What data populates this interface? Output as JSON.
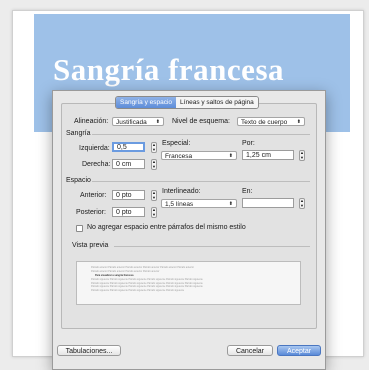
{
  "document": {
    "title": "Sangría francesa",
    "background_color": "#9ec1e8"
  },
  "dialog": {
    "tabs": [
      {
        "label": "Sangría y espacio",
        "active": true
      },
      {
        "label": "Líneas y saltos de página",
        "active": false
      }
    ],
    "alignment": {
      "label": "Alineación:",
      "value": "Justificada"
    },
    "outline_level": {
      "label": "Nivel de esquema:",
      "value": "Texto de cuerpo"
    },
    "indent": {
      "section_label": "Sangría",
      "left": {
        "label": "Izquierda:",
        "value": "0,5"
      },
      "right": {
        "label": "Derecha:",
        "value": "0 cm"
      },
      "special": {
        "label": "Especial:",
        "value": "Francesa"
      },
      "by": {
        "label": "Por:",
        "value": "1,25 cm"
      }
    },
    "spacing": {
      "section_label": "Espacio",
      "before": {
        "label": "Anterior:",
        "value": "0 pto"
      },
      "after": {
        "label": "Posterior:",
        "value": "0 pto"
      },
      "line_spacing": {
        "label": "Interlineado:",
        "value": "1,5 líneas"
      },
      "at": {
        "label": "En:",
        "value": ""
      },
      "no_space_label": "No agregar espacio entre párrafos del mismo estilo",
      "no_space_checked": false
    },
    "preview": {
      "label": "Vista previa",
      "before_lines": [
        "Párrafo anterior Párrafo anterior Párrafo anterior Párrafo anterior Párrafo anterior Párrafo anterior",
        "Párrafo anterior Párrafo anterior Párrafo anterior Párrafo anterior"
      ],
      "sample_line": "Para visualizar a sangría francesa",
      "after_lines": [
        "Párrafo siguiente Párrafo siguiente Párrafo siguiente Párrafo siguiente Párrafo siguiente Párrafo siguiente",
        "Párrafo siguiente Párrafo siguiente Párrafo siguiente Párrafo siguiente Párrafo siguiente Párrafo siguiente",
        "Párrafo siguiente Párrafo siguiente Párrafo siguiente Párrafo siguiente Párrafo siguiente Párrafo siguiente",
        "Párrafo siguiente Párrafo siguiente Párrafo siguiente Párrafo siguiente Párrafo siguiente"
      ]
    },
    "buttons": {
      "tabs_button": "Tabulaciones...",
      "cancel": "Cancelar",
      "accept": "Aceptar"
    },
    "accent_color": "#5a8ad8"
  }
}
